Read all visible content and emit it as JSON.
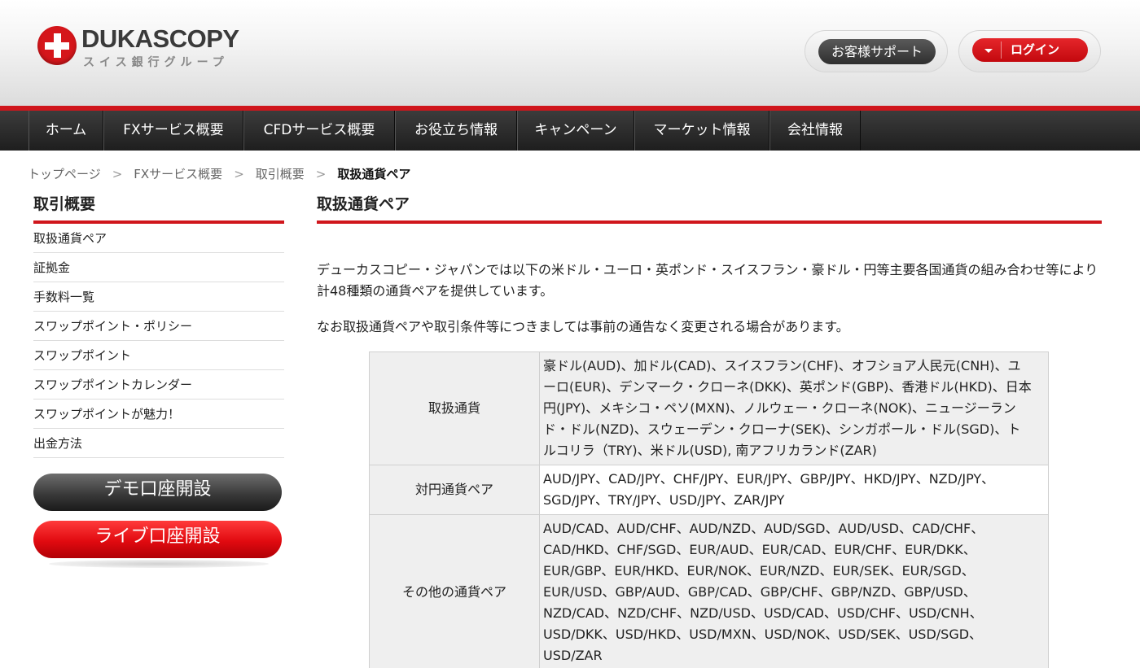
{
  "header": {
    "logo_name": "DUKASCOPY",
    "logo_sub": "スイス銀行グループ",
    "support_label": "お客様サポート",
    "login_label": "ログイン"
  },
  "nav": {
    "items": [
      "ホーム",
      "FXサービス概要",
      "CFDサービス概要",
      "お役立ち情報",
      "キャンペーン",
      "マーケット情報",
      "会社情報"
    ]
  },
  "breadcrumb": {
    "items": [
      "トップページ",
      "FXサービス概要",
      "取引概要"
    ],
    "current": "取扱通貨ペア",
    "separator": ">"
  },
  "sidebar": {
    "title": "取引概要",
    "items": [
      "取扱通貨ペア",
      "証拠金",
      "手数料一覧",
      "スワップポイント・ポリシー",
      "スワップポイント",
      "スワップポイントカレンダー",
      "スワップポイントが魅力！",
      "出金方法"
    ],
    "demo_button": "デモ口座開設",
    "live_button": "ライブ口座開設"
  },
  "main": {
    "title": "取扱通貨ペア",
    "intro": "デューカスコピー・ジャパンでは以下の米ドル・ユーロ・英ポンド・スイスフラン・豪ドル・円等主要各国通貨の組み合わせ等により計48種類の通貨ペアを提供しています。",
    "notice": "なお取扱通貨ペアや取引条件等につきましては事前の通告なく変更される場合があります。",
    "table": [
      {
        "label": "取扱通貨",
        "value": "豪ドル(AUD)、加ドル(CAD)、スイスフラン(CHF)、オフショア人民元(CNH)、ユーロ(EUR)、デンマーク・クローネ(DKK)、英ポンド(GBP)、香港ドル(HKD)、日本円(JPY)、メキシコ・ペソ(MXN)、ノルウェー・クローネ(NOK)、ニュージーランド・ドル(NZD)、スウェーデン・クローナ(SEK)、シンガポール・ドル(SGD)、トルコリラ（TRY)、米ドル(USD), 南アフリカランド(ZAR)"
      },
      {
        "label": "対円通貨ペア",
        "value": "AUD/JPY、CAD/JPY、CHF/JPY、EUR/JPY、GBP/JPY、HKD/JPY、NZD/JPY、SGD/JPY、TRY/JPY、USD/JPY、ZAR/JPY"
      },
      {
        "label": "その他の通貨ペア",
        "value": "AUD/CAD、AUD/CHF、AUD/NZD、AUD/SGD、AUD/USD、CAD/CHF、CAD/HKD、CHF/SGD、EUR/AUD、EUR/CAD、EUR/CHF、EUR/DKK、EUR/GBP、EUR/HKD、EUR/NOK、EUR/NZD、EUR/SEK、EUR/SGD、EUR/USD、GBP/AUD、GBP/CAD、GBP/CHF、GBP/NZD、GBP/USD、NZD/CAD、NZD/CHF、NZD/USD、USD/CAD、USD/CHF、USD/CNH、USD/DKK、USD/HKD、USD/MXN、USD/NOK、USD/SEK、USD/SGD、USD/ZAR"
      }
    ]
  }
}
